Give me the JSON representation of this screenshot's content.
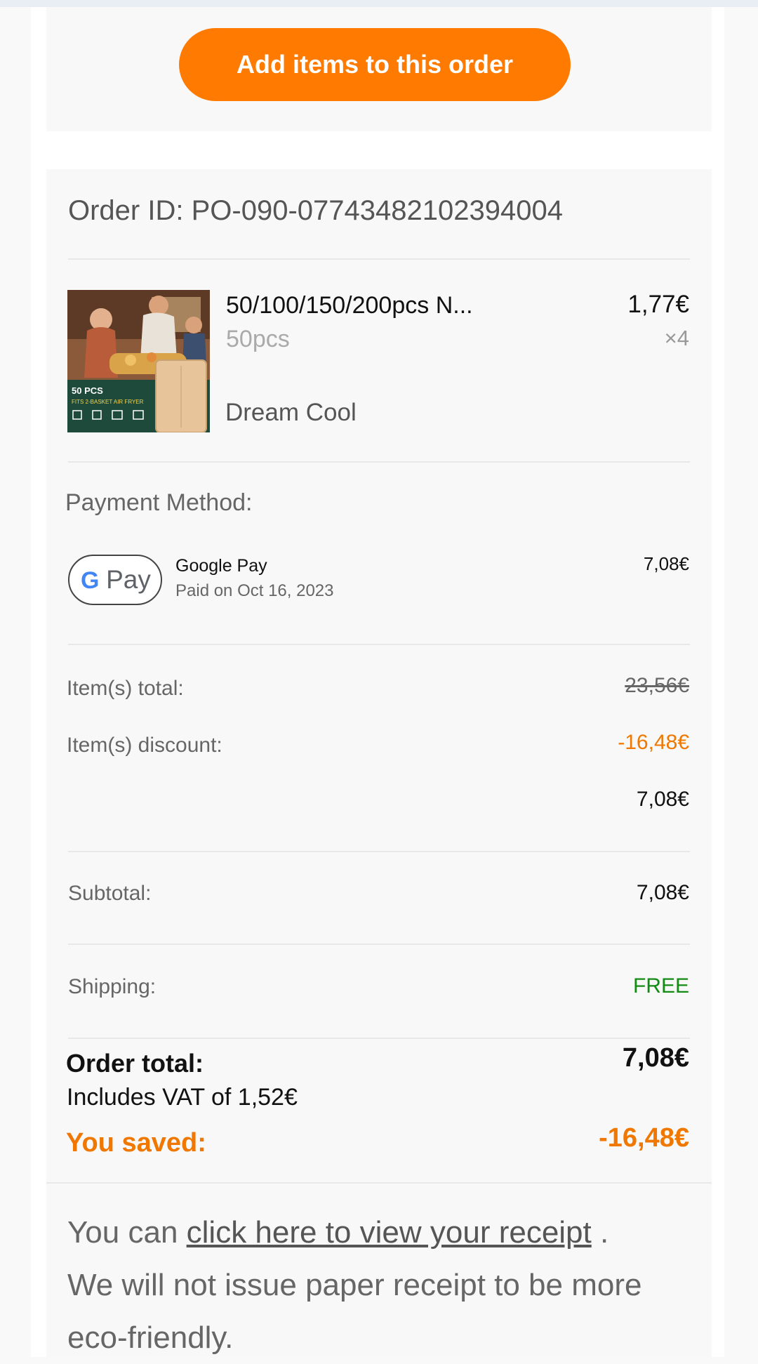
{
  "cta": {
    "add_items_label": "Add items to this order"
  },
  "order": {
    "id_text": "Order ID: PO-090-07743482102394004",
    "item": {
      "title": "50/100/150/200pcs N...",
      "variant": "50pcs",
      "store": "Dream Cool",
      "price": "1,77€",
      "quantity": "×4",
      "thumb_text_1": "50 PCS",
      "thumb_text_2": "FITS 2-BASKET AIR FRYER"
    }
  },
  "payment": {
    "label": "Payment Method:",
    "badge_text": "Pay",
    "badge_g": "G",
    "method": "Google Pay",
    "date": "Paid on Oct 16, 2023",
    "amount": "7,08€"
  },
  "summary": {
    "items_total_label": "Item(s) total:",
    "items_total_value": "23,56€",
    "items_discount_label": "Item(s) discount:",
    "items_discount_value": "-16,48€",
    "after_discount_value": "7,08€",
    "subtotal_label": "Subtotal:",
    "subtotal_value": "7,08€",
    "shipping_label": "Shipping:",
    "shipping_value": "FREE",
    "order_total_label": "Order total:",
    "order_total_value": "7,08€",
    "vat_text": "Includes VAT of 1,52€",
    "saved_label": "You saved:",
    "saved_value": "-16,48€"
  },
  "receipt": {
    "prefix": "You can ",
    "link": "click here to view your receipt",
    "suffix": " .",
    "line2": "We will not issue paper receipt to be more eco-friendly."
  },
  "colors": {
    "accent": "#ff7a00",
    "saved": "#f07800",
    "free": "#138a13"
  }
}
